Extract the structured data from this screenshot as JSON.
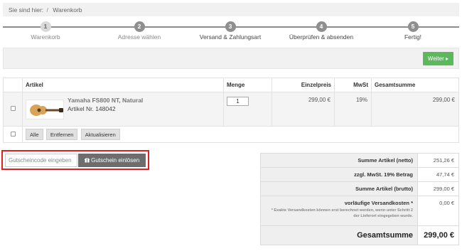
{
  "breadcrumb": {
    "prefix": "Sie sind hier:",
    "separator": "/",
    "current": "Warenkorb"
  },
  "steps": [
    {
      "num": "1",
      "label": "Warenkorb"
    },
    {
      "num": "2",
      "label": "Adresse wählen"
    },
    {
      "num": "3",
      "label": "Versand & Zahlungsart"
    },
    {
      "num": "4",
      "label": "Überprüfen & absenden"
    },
    {
      "num": "5",
      "label": "Fertig!"
    }
  ],
  "actionbar": {
    "next_label": "Weiter ▸"
  },
  "cart": {
    "columns": [
      "Artikel",
      "Menge",
      "Einzelpreis",
      "MwSt",
      "Gesamtsumme"
    ],
    "items": [
      {
        "name": "Yamaha FS800 NT, Natural",
        "article_nr": "Artikel Nr. 148042",
        "quantity": "1",
        "unit_price": "299,00 €",
        "vat": "19%",
        "total": "299,00 €"
      }
    ],
    "footer_buttons": {
      "all": "Alle",
      "remove": "Entfernen",
      "update": "Aktualisieren"
    }
  },
  "voucher": {
    "placeholder": "Gutscheincode eingeben",
    "button": "Gutschein einlösen",
    "button_icon": "gift-icon"
  },
  "totals": {
    "net_label": "Summe Artikel (netto)",
    "net_value": "251,26 €",
    "vat_label": "zzgl. MwSt. 19% Betrag",
    "vat_value": "47,74 €",
    "gross_label": "Summe Artikel (brutto)",
    "gross_value": "299,00 €",
    "shipping_label": "vorläufige Versandkosten *",
    "shipping_note": "* Exakte Versandkosten können erst berechnet werden, wenn unter Schritt 2 der Lieferort eingegeben wurde.",
    "shipping_value": "0,00 €",
    "grand_label": "Gesamtsumme",
    "grand_value": "299,00 €"
  },
  "colors": {
    "next_button": "#5cb85c",
    "voucher_highlight": "#e02020",
    "voucher_button": "#6d6d6d"
  }
}
